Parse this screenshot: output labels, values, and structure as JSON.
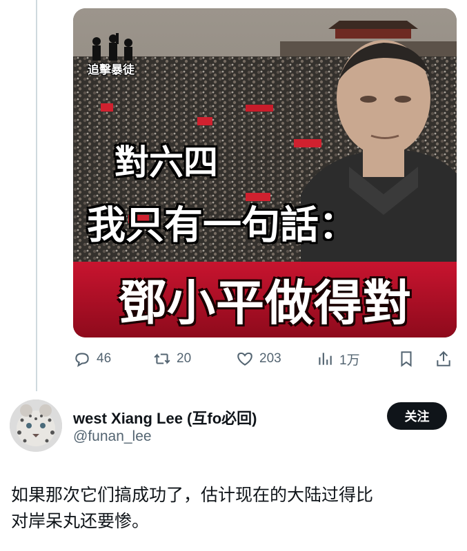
{
  "quoted_post": {
    "image": {
      "logo_text": "追擊暴徒",
      "line1": "對六四",
      "line2": "我只有一句話：",
      "line3": "鄧小平做得對"
    },
    "actions": {
      "reply_count": "46",
      "retweet_count": "20",
      "like_count": "203",
      "views_count": "1万",
      "icons": [
        "reply-icon",
        "retweet-icon",
        "like-icon",
        "views-icon",
        "bookmark-icon",
        "share-icon"
      ]
    }
  },
  "reply_post": {
    "display_name": "west Xiang Lee (互fo必回)",
    "handle": "@funan_lee",
    "follow_label": "关注",
    "text_line1": "如果那次它们搞成功了，估计现在的大陆过得比",
    "text_line2": "对岸呆丸还要惨。"
  },
  "colors": {
    "text_primary": "#0f1419",
    "text_secondary": "#536471",
    "thread_line": "#cfd9de",
    "follow_button": "#0f1419",
    "banner_red": "#b8102a"
  }
}
